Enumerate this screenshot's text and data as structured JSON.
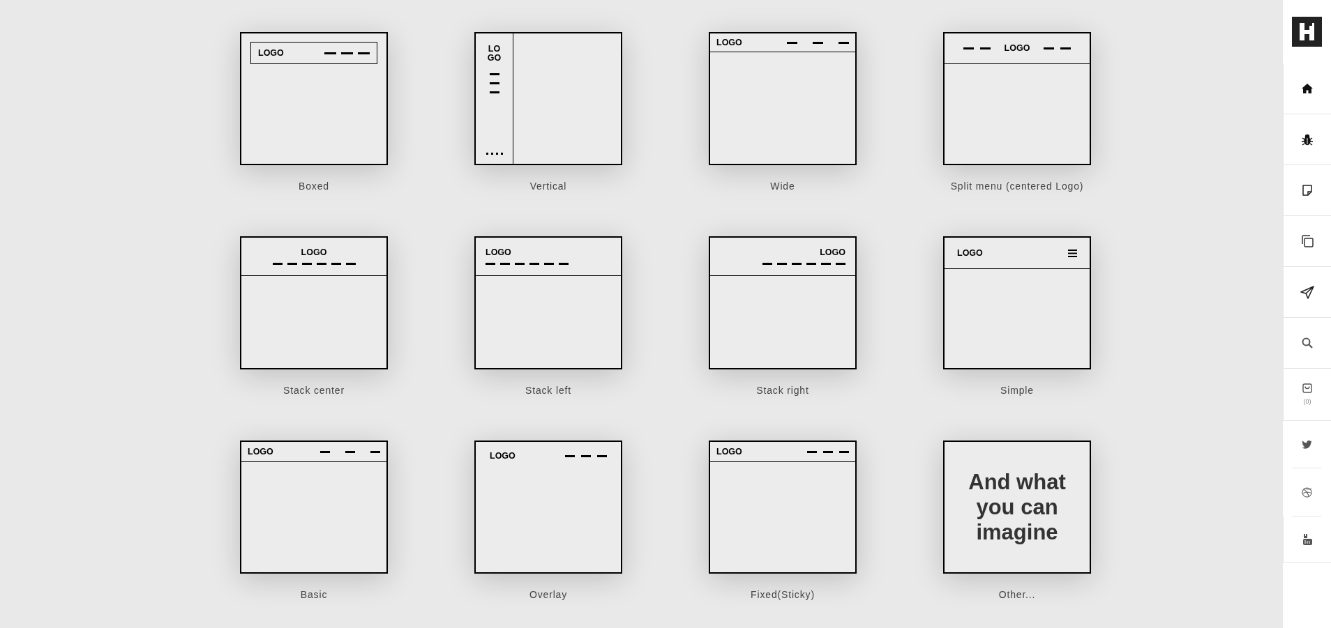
{
  "cards": [
    {
      "kind": "boxed",
      "logo": "LOGO",
      "label": "Boxed"
    },
    {
      "kind": "vertical",
      "logo": "LOGO",
      "label": "Vertical"
    },
    {
      "kind": "wide",
      "logo": "LOGO",
      "label": "Wide"
    },
    {
      "kind": "split",
      "logo": "LOGO",
      "label": "Split menu (centered Logo)"
    },
    {
      "kind": "stack_center",
      "logo": "LOGO",
      "label": "Stack center"
    },
    {
      "kind": "stack_left",
      "logo": "LOGO",
      "label": "Stack left"
    },
    {
      "kind": "stack_right",
      "logo": "LOGO",
      "label": "Stack right"
    },
    {
      "kind": "simple",
      "logo": "LOGO",
      "label": "Simple"
    },
    {
      "kind": "basic",
      "logo": "LOGO",
      "label": "Basic"
    },
    {
      "kind": "overlay",
      "logo": "LOGO",
      "label": "Overlay"
    },
    {
      "kind": "fixed",
      "logo": "LOGO",
      "label": "Fixed(Sticky)"
    },
    {
      "kind": "text",
      "text": "And what you can imagine",
      "label": "Other..."
    }
  ],
  "sidebar": {
    "items": [
      {
        "kind": "home"
      },
      {
        "kind": "bug"
      },
      {
        "kind": "note"
      },
      {
        "kind": "copy"
      },
      {
        "kind": "send"
      },
      {
        "kind": "search"
      },
      {
        "kind": "cart",
        "count": "(0)"
      },
      {
        "kind": "twitter"
      },
      {
        "kind": "dribbble"
      },
      {
        "kind": "youtube"
      }
    ]
  }
}
